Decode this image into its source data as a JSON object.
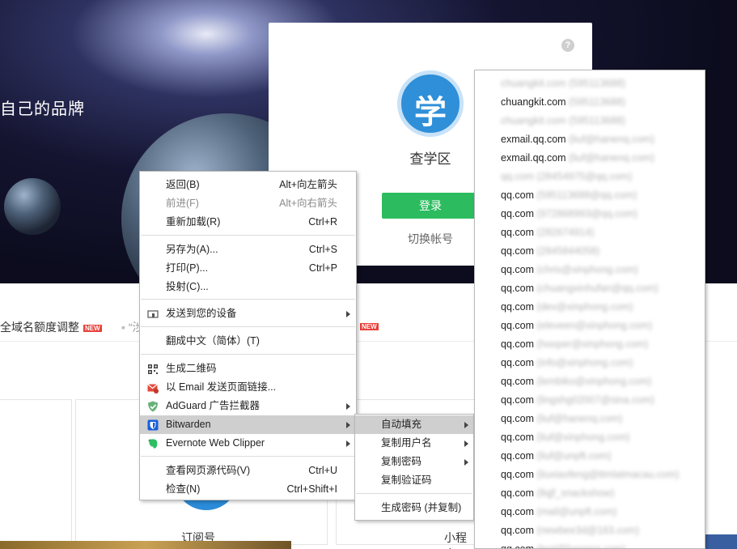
{
  "page": {
    "banner_text": "自己的品牌",
    "news": [
      {
        "text": "全域名额度调整",
        "badge": "NEW"
      },
      {
        "text": "“涉",
        "badge": ""
      },
      {
        "text": "",
        "badge": "NEW"
      }
    ],
    "cards": [
      {
        "label": "订阅号"
      },
      {
        "label": "小程序"
      }
    ]
  },
  "login": {
    "help_icon": "question-icon",
    "logo_glyph": "学",
    "app_name": "查学区",
    "login_button": "登录",
    "switch_account": "切换帐号"
  },
  "context_menu": {
    "items": [
      {
        "label": "返回(B)",
        "shortcut": "Alt+向左箭头",
        "disabled": false
      },
      {
        "label": "前进(F)",
        "shortcut": "Alt+向右箭头",
        "disabled": true
      },
      {
        "label": "重新加载(R)",
        "shortcut": "Ctrl+R",
        "disabled": false
      },
      {
        "label": "另存为(A)...",
        "shortcut": "Ctrl+S",
        "disabled": false
      },
      {
        "label": "打印(P)...",
        "shortcut": "Ctrl+P",
        "disabled": false
      },
      {
        "label": "投射(C)...",
        "shortcut": "",
        "disabled": false
      },
      {
        "label": "发送到您的设备",
        "icon": "device-icon",
        "submenu": true
      },
      {
        "label": "翻成中文（简体）(T)",
        "shortcut": ""
      },
      {
        "label": "生成二维码",
        "icon": "qr-code-icon"
      },
      {
        "label": "以 Email 发送页面链接...",
        "icon": "email-icon"
      },
      {
        "label": "AdGuard 广告拦截器",
        "icon": "adguard-shield-icon",
        "submenu": true
      },
      {
        "label": "Bitwarden",
        "icon": "bitwarden-icon",
        "submenu": true,
        "highlighted": true
      },
      {
        "label": "Evernote Web Clipper",
        "icon": "evernote-icon",
        "submenu": true
      },
      {
        "label": "查看网页源代码(V)",
        "shortcut": "Ctrl+U"
      },
      {
        "label": "检查(N)",
        "shortcut": "Ctrl+Shift+I"
      }
    ]
  },
  "bitwarden_submenu": {
    "items": [
      {
        "label": "自动填充",
        "submenu": true,
        "highlighted": true
      },
      {
        "label": "复制用户名",
        "submenu": true
      },
      {
        "label": "复制密码",
        "submenu": true
      },
      {
        "label": "复制验证码",
        "submenu": false
      },
      {
        "label": "生成密码 (并复制)",
        "submenu": false
      }
    ]
  },
  "autofill_accounts": [
    {
      "site": "chuangkit.com",
      "detail": "(595113688)",
      "site_blurred": true
    },
    {
      "site": "chuangkit.com",
      "detail": "(595113688)",
      "site_blurred": false
    },
    {
      "site": "chuangkit.com",
      "detail": "(595113688)",
      "site_blurred": true
    },
    {
      "site": "exmail.qq.com",
      "detail": "(liuf@hanenq.com)",
      "site_blurred": false
    },
    {
      "site": "exmail.qq.com",
      "detail": "(liuf@hanenq.com)",
      "site_blurred": false
    },
    {
      "site": "qq.com",
      "detail": "(28454975@qq.com)",
      "site_blurred": true
    },
    {
      "site": "qq.com",
      "detail": "(595113688@qq.com)",
      "site_blurred": false
    },
    {
      "site": "qq.com",
      "detail": "(972868993@qq.com)",
      "site_blurred": false
    },
    {
      "site": "qq.com",
      "detail": "(282674914)",
      "site_blurred": false
    },
    {
      "site": "qq.com",
      "detail": "(2845844058)",
      "site_blurred": false
    },
    {
      "site": "qq.com",
      "detail": "(chris@xinphong.com)",
      "site_blurred": false
    },
    {
      "site": "qq.com",
      "detail": "(chuangxinhufan@qq.com)",
      "site_blurred": false
    },
    {
      "site": "qq.com",
      "detail": "(dev@xinphong.com)",
      "site_blurred": false
    },
    {
      "site": "qq.com",
      "detail": "(eleveen@xinphong.com)",
      "site_blurred": false
    },
    {
      "site": "qq.com",
      "detail": "(hooper@xinphong.com)",
      "site_blurred": false
    },
    {
      "site": "qq.com",
      "detail": "(info@xinphong.com)",
      "site_blurred": false
    },
    {
      "site": "qq.com",
      "detail": "(lembiko@xinphong.com)",
      "site_blurred": false
    },
    {
      "site": "qq.com",
      "detail": "(lingshg02007@sina.com)",
      "site_blurred": false
    },
    {
      "site": "qq.com",
      "detail": "(liuf@hanenq.com)",
      "site_blurred": false
    },
    {
      "site": "qq.com",
      "detail": "(liuf@xinphong.com)",
      "site_blurred": false
    },
    {
      "site": "qq.com",
      "detail": "(liuf@unpft.com)",
      "site_blurred": false
    },
    {
      "site": "qq.com",
      "detail": "(liuxiaofeng@ttmlatmacau.com)",
      "site_blurred": false
    },
    {
      "site": "qq.com",
      "detail": "(llqjf_snackshow)",
      "site_blurred": false
    },
    {
      "site": "qq.com",
      "detail": "(mail@unpft.com)",
      "site_blurred": false
    },
    {
      "site": "qq.com",
      "detail": "(newbee3d@163.com)",
      "site_blurred": false
    },
    {
      "site": "qq.com",
      "detail": "(test@hanenq.com)",
      "site_blurred": false
    }
  ]
}
